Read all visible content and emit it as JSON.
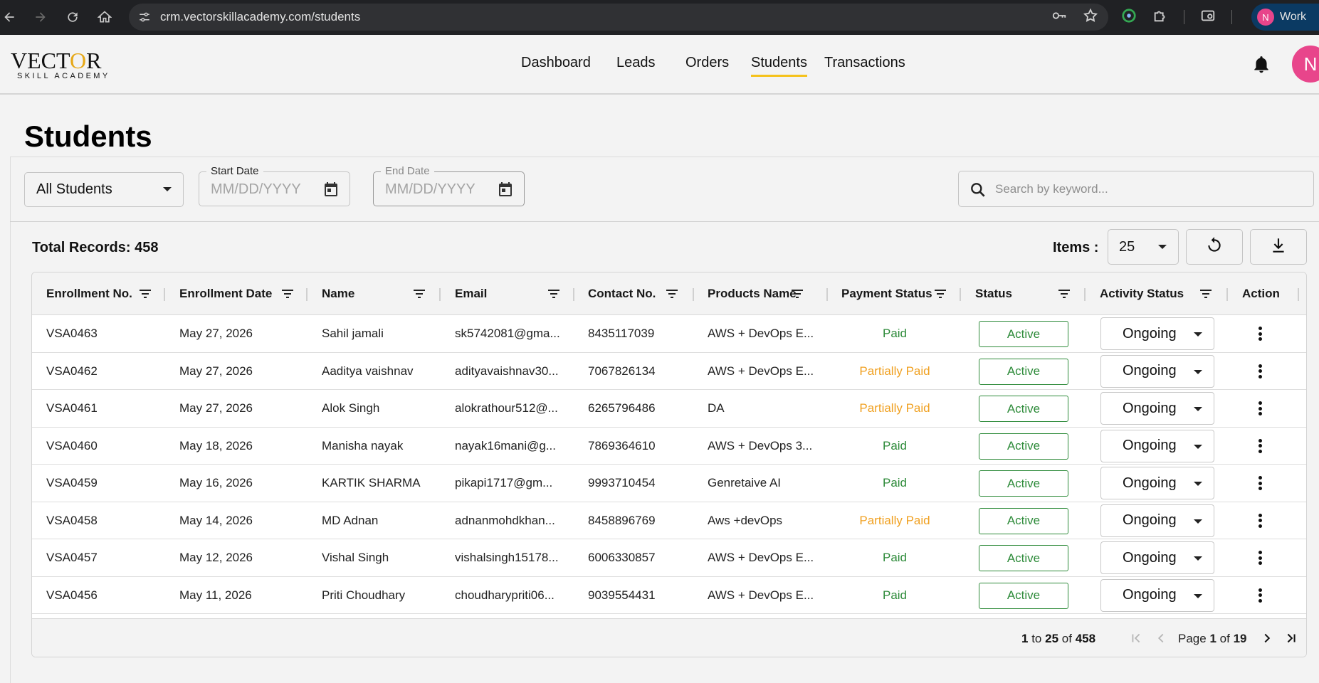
{
  "browser": {
    "url": "crm.vectorskillacademy.com/students",
    "profile_initial": "N",
    "profile_label": "Work"
  },
  "header": {
    "logo_main_1": "VECT",
    "logo_main_o": "O",
    "logo_main_2": "R",
    "logo_sub": "SKILL ACADEMY",
    "nav": [
      "Dashboard",
      "Leads",
      "Orders",
      "Students",
      "Transactions"
    ],
    "active_nav": "Students",
    "avatar_initial": "N"
  },
  "page": {
    "title": "Students"
  },
  "filters": {
    "student_filter": "All Students",
    "start_date_label": "Start Date",
    "start_date_placeholder": "MM/DD/YYYY",
    "end_date_label": "End Date",
    "end_date_placeholder": "MM/DD/YYYY",
    "search_placeholder": "Search by keyword..."
  },
  "toolbar": {
    "total_records": "Total Records: 458",
    "items_label": "Items :",
    "items_value": "25"
  },
  "table": {
    "columns": [
      "Enrollment No.",
      "Enrollment Date",
      "Name",
      "Email",
      "Contact No.",
      "Products Name",
      "Payment Status",
      "Status",
      "Activity Status",
      "Action"
    ],
    "rows": [
      {
        "enrollment_no": "VSA0463",
        "date": "May 27, 2026",
        "name": "Sahil jamali",
        "email": "sk5742081@gma...",
        "contact": "8435117039",
        "product": "AWS + DevOps E...",
        "payment": "Paid",
        "status": "Active",
        "activity": "Ongoing"
      },
      {
        "enrollment_no": "VSA0462",
        "date": "May 27, 2026",
        "name": "Aaditya vaishnav",
        "email": "adityavaishnav30...",
        "contact": "7067826134",
        "product": "AWS + DevOps E...",
        "payment": "Partially Paid",
        "status": "Active",
        "activity": "Ongoing"
      },
      {
        "enrollment_no": "VSA0461",
        "date": "May 27, 2026",
        "name": "Alok Singh",
        "email": "alokrathour512@...",
        "contact": "6265796486",
        "product": "DA",
        "payment": "Partially Paid",
        "status": "Active",
        "activity": "Ongoing"
      },
      {
        "enrollment_no": "VSA0460",
        "date": "May 18, 2026",
        "name": "Manisha nayak",
        "email": "nayak16mani@g...",
        "contact": "7869364610",
        "product": "AWS + DevOps 3...",
        "payment": "Paid",
        "status": "Active",
        "activity": "Ongoing"
      },
      {
        "enrollment_no": "VSA0459",
        "date": "May 16, 2026",
        "name": "KARTIK SHARMA",
        "email": "pikapi1717@gm...",
        "contact": "9993710454",
        "product": "Genretaive AI",
        "payment": "Paid",
        "status": "Active",
        "activity": "Ongoing"
      },
      {
        "enrollment_no": "VSA0458",
        "date": "May 14, 2026",
        "name": "MD Adnan",
        "email": "adnanmohdkhan...",
        "contact": "8458896769",
        "product": "Aws +devOps",
        "payment": "Partially Paid",
        "status": "Active",
        "activity": "Ongoing"
      },
      {
        "enrollment_no": "VSA0457",
        "date": "May 12, 2026",
        "name": "Vishal Singh",
        "email": "vishalsingh15178...",
        "contact": "6006330857",
        "product": "AWS + DevOps E...",
        "payment": "Paid",
        "status": "Active",
        "activity": "Ongoing"
      },
      {
        "enrollment_no": "VSA0456",
        "date": "May 11, 2026",
        "name": "Priti Choudhary",
        "email": "choudharypriti06...",
        "contact": "9039554431",
        "product": "AWS + DevOps E...",
        "payment": "Paid",
        "status": "Active",
        "activity": "Ongoing"
      }
    ]
  },
  "pagination": {
    "from": "1",
    "to_word": "to",
    "to": "25",
    "of_word": "of",
    "total": "458",
    "page_word": "Page",
    "page": "1",
    "page_of_word": "of",
    "pages": "19"
  },
  "colors": {
    "accent": "#f5c21b",
    "paid": "#2e8b3a",
    "partially_paid": "#f0a020",
    "avatar": "#e8458b"
  },
  "icons": [
    "back-arrow-icon",
    "forward-arrow-icon",
    "reload-icon",
    "home-icon",
    "site-settings-icon",
    "key-icon",
    "star-icon",
    "extension-icon",
    "puzzle-icon",
    "bell-icon",
    "calendar-icon",
    "search-icon",
    "refresh-icon",
    "download-icon",
    "filter-icon",
    "more-vert-icon",
    "first-page-icon",
    "prev-page-icon",
    "next-page-icon",
    "last-page-icon"
  ]
}
